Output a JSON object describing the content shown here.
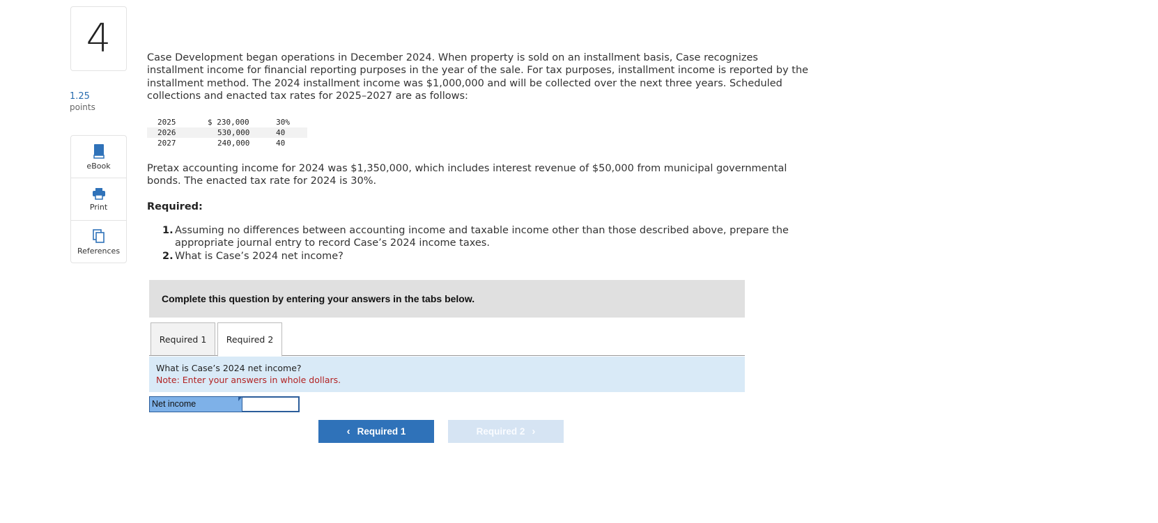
{
  "question": {
    "number": "4",
    "points_value": "1.25",
    "points_label": "points"
  },
  "tools": [
    {
      "label": "eBook",
      "icon": "book-icon"
    },
    {
      "label": "Print",
      "icon": "printer-icon"
    },
    {
      "label": "References",
      "icon": "copy-documents-icon"
    }
  ],
  "intro": "Case Development began operations in December 2024. When property is sold on an installment basis, Case recognizes installment income for financial reporting purposes in the year of the sale. For tax purposes, installment income is reported by the installment method. The 2024 installment income was $1,000,000 and will be collected over the next three years. Scheduled collections and enacted tax rates for 2025–2027 are as follows:",
  "schedule": [
    {
      "year": "2025",
      "amount": "$ 230,000",
      "rate": "30%"
    },
    {
      "year": "2026",
      "amount": "530,000",
      "rate": "40"
    },
    {
      "year": "2027",
      "amount": "240,000",
      "rate": "40"
    }
  ],
  "pretax": "Pretax accounting income for 2024 was $1,350,000, which includes interest revenue of $50,000 from municipal governmental bonds. The enacted tax rate for 2024 is 30%.",
  "required_heading": "Required:",
  "requirements": [
    {
      "num": "1.",
      "text": "Assuming no differences between accounting income and taxable income other than those described above, prepare the appropriate journal entry to record Case’s 2024 income taxes."
    },
    {
      "num": "2.",
      "text": "What is Case’s 2024 net income?"
    }
  ],
  "instruction": "Complete this question by entering your answers in the tabs below.",
  "tabs": [
    {
      "label": "Required 1",
      "active": false
    },
    {
      "label": "Required 2",
      "active": true
    }
  ],
  "panel": {
    "question": "What is Case’s 2024 net income?",
    "note": "Note: Enter your answers in whole dollars."
  },
  "answer": {
    "label": "Net income",
    "value": ""
  },
  "nav": {
    "prev_label": "Required 1",
    "next_label": "Required 2"
  },
  "colors": {
    "accent": "#2f72b9",
    "panel_bg": "#d9eaf7",
    "note_red": "#b22222"
  }
}
